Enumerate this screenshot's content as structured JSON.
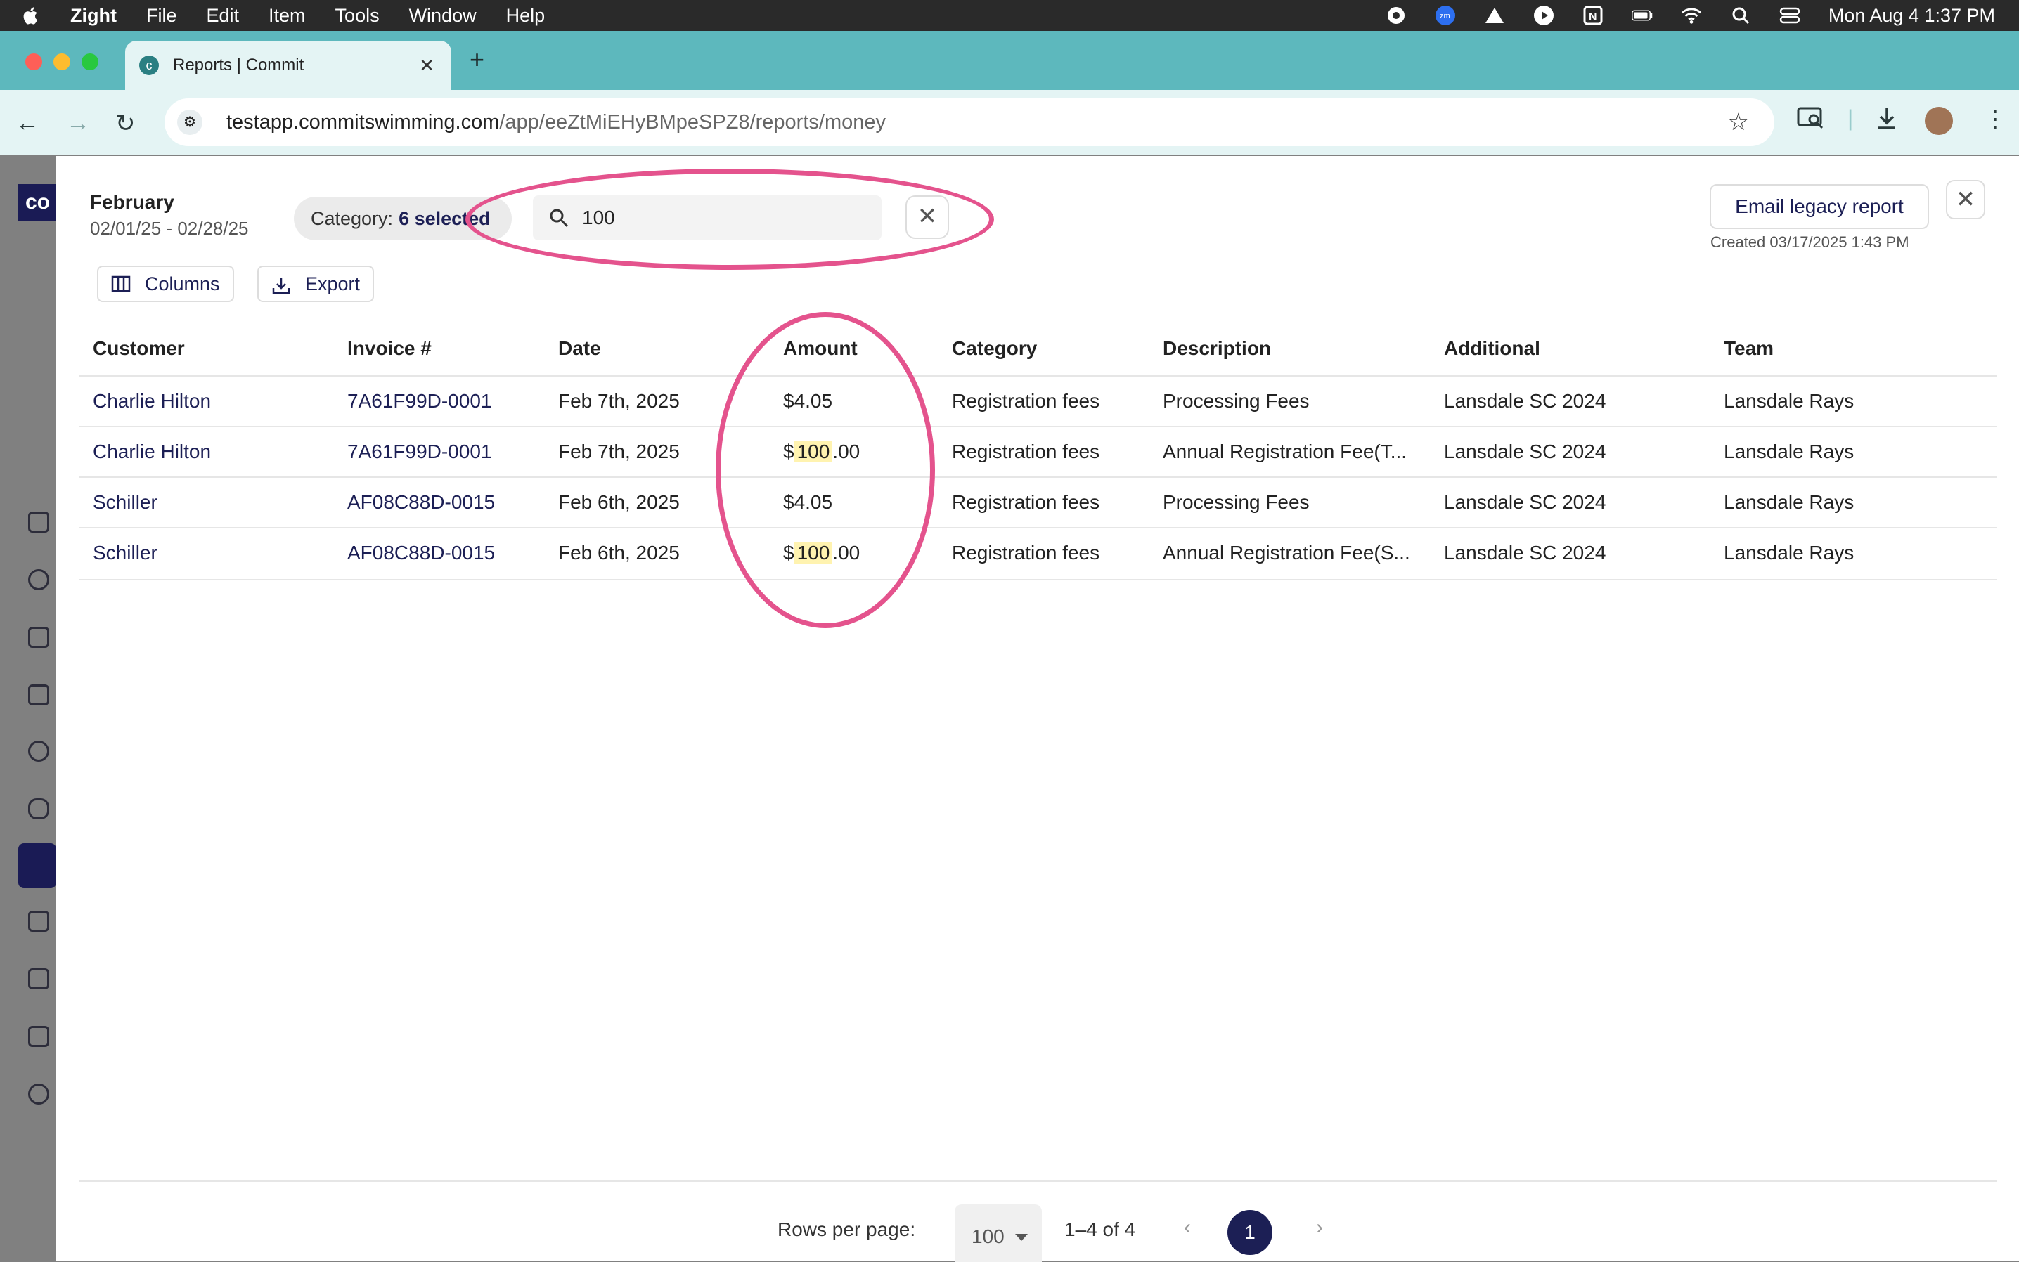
{
  "menubar": {
    "app_name": "Zight",
    "menus": [
      "File",
      "Edit",
      "Item",
      "Tools",
      "Window",
      "Help"
    ],
    "datetime": "Mon Aug 4  1:37 PM"
  },
  "browser": {
    "tab_title": "Reports | Commit",
    "url_host": "testapp.commitswimming.com",
    "url_path": "/app/eeZtMiEHyBMpeSPZ8/reports/money"
  },
  "sidebar": {
    "logo_text": "co"
  },
  "report": {
    "period_label": "February",
    "period_range": "02/01/25 - 02/28/25",
    "category_filter_label": "Category:",
    "category_filter_value": "6 selected",
    "search_value": "100",
    "email_button_label": "Email legacy report",
    "created_text": "Created 03/17/2025 1:43 PM",
    "columns_button_label": "Columns",
    "export_button_label": "Export"
  },
  "table": {
    "columns": [
      "Customer",
      "Invoice #",
      "Date",
      "Amount",
      "Category",
      "Description",
      "Additional",
      "Team"
    ],
    "rows": [
      {
        "customer": "Charlie Hilton",
        "invoice": "7A61F99D-0001",
        "date": "Feb 7th, 2025",
        "amount_pre": "$4.05",
        "amount_mark": "",
        "amount_post": "",
        "category": "Registration fees",
        "description": "Processing Fees",
        "additional": "Lansdale SC 2024",
        "team": "Lansdale Rays"
      },
      {
        "customer": "Charlie Hilton",
        "invoice": "7A61F99D-0001",
        "date": "Feb 7th, 2025",
        "amount_pre": "$",
        "amount_mark": "100",
        "amount_post": ".00",
        "category": "Registration fees",
        "description": "Annual Registration Fee(T...",
        "additional": "Lansdale SC 2024",
        "team": "Lansdale Rays"
      },
      {
        "customer": "Schiller",
        "invoice": "AF08C88D-0015",
        "date": "Feb 6th, 2025",
        "amount_pre": "$4.05",
        "amount_mark": "",
        "amount_post": "",
        "category": "Registration fees",
        "description": "Processing Fees",
        "additional": "Lansdale SC 2024",
        "team": "Lansdale Rays"
      },
      {
        "customer": "Schiller",
        "invoice": "AF08C88D-0015",
        "date": "Feb 6th, 2025",
        "amount_pre": "$",
        "amount_mark": "100",
        "amount_post": ".00",
        "category": "Registration fees",
        "description": "Annual Registration Fee(S...",
        "additional": "Lansdale SC 2024",
        "team": "Lansdale Rays"
      }
    ]
  },
  "pagination": {
    "rows_per_page_label": "Rows per page:",
    "rows_per_page_value": "100",
    "range_text": "1–4 of 4",
    "current_page": "1"
  },
  "colors": {
    "annotation": "#e4538d",
    "brand_navy": "#1c1f55",
    "tab_bar": "#5db8bd",
    "highlight": "#fff3b0"
  }
}
